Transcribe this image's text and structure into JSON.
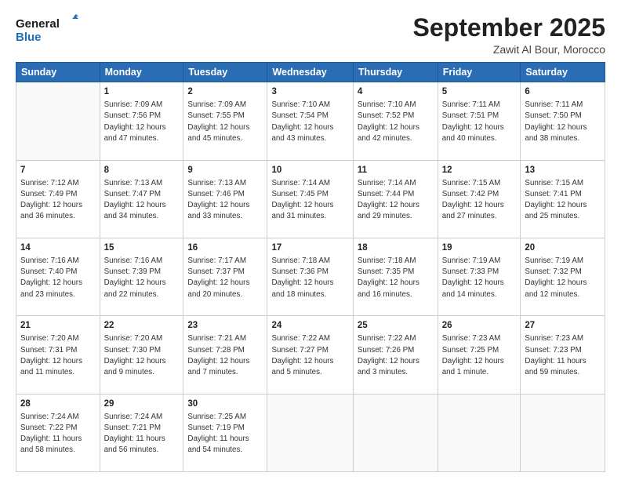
{
  "logo": {
    "line1": "General",
    "line2": "Blue"
  },
  "title": "September 2025",
  "location": "Zawit Al Bour, Morocco",
  "days_header": [
    "Sunday",
    "Monday",
    "Tuesday",
    "Wednesday",
    "Thursday",
    "Friday",
    "Saturday"
  ],
  "weeks": [
    [
      {
        "day": "",
        "info": ""
      },
      {
        "day": "1",
        "info": "Sunrise: 7:09 AM\nSunset: 7:56 PM\nDaylight: 12 hours\nand 47 minutes."
      },
      {
        "day": "2",
        "info": "Sunrise: 7:09 AM\nSunset: 7:55 PM\nDaylight: 12 hours\nand 45 minutes."
      },
      {
        "day": "3",
        "info": "Sunrise: 7:10 AM\nSunset: 7:54 PM\nDaylight: 12 hours\nand 43 minutes."
      },
      {
        "day": "4",
        "info": "Sunrise: 7:10 AM\nSunset: 7:52 PM\nDaylight: 12 hours\nand 42 minutes."
      },
      {
        "day": "5",
        "info": "Sunrise: 7:11 AM\nSunset: 7:51 PM\nDaylight: 12 hours\nand 40 minutes."
      },
      {
        "day": "6",
        "info": "Sunrise: 7:11 AM\nSunset: 7:50 PM\nDaylight: 12 hours\nand 38 minutes."
      }
    ],
    [
      {
        "day": "7",
        "info": "Sunrise: 7:12 AM\nSunset: 7:49 PM\nDaylight: 12 hours\nand 36 minutes."
      },
      {
        "day": "8",
        "info": "Sunrise: 7:13 AM\nSunset: 7:47 PM\nDaylight: 12 hours\nand 34 minutes."
      },
      {
        "day": "9",
        "info": "Sunrise: 7:13 AM\nSunset: 7:46 PM\nDaylight: 12 hours\nand 33 minutes."
      },
      {
        "day": "10",
        "info": "Sunrise: 7:14 AM\nSunset: 7:45 PM\nDaylight: 12 hours\nand 31 minutes."
      },
      {
        "day": "11",
        "info": "Sunrise: 7:14 AM\nSunset: 7:44 PM\nDaylight: 12 hours\nand 29 minutes."
      },
      {
        "day": "12",
        "info": "Sunrise: 7:15 AM\nSunset: 7:42 PM\nDaylight: 12 hours\nand 27 minutes."
      },
      {
        "day": "13",
        "info": "Sunrise: 7:15 AM\nSunset: 7:41 PM\nDaylight: 12 hours\nand 25 minutes."
      }
    ],
    [
      {
        "day": "14",
        "info": "Sunrise: 7:16 AM\nSunset: 7:40 PM\nDaylight: 12 hours\nand 23 minutes."
      },
      {
        "day": "15",
        "info": "Sunrise: 7:16 AM\nSunset: 7:39 PM\nDaylight: 12 hours\nand 22 minutes."
      },
      {
        "day": "16",
        "info": "Sunrise: 7:17 AM\nSunset: 7:37 PM\nDaylight: 12 hours\nand 20 minutes."
      },
      {
        "day": "17",
        "info": "Sunrise: 7:18 AM\nSunset: 7:36 PM\nDaylight: 12 hours\nand 18 minutes."
      },
      {
        "day": "18",
        "info": "Sunrise: 7:18 AM\nSunset: 7:35 PM\nDaylight: 12 hours\nand 16 minutes."
      },
      {
        "day": "19",
        "info": "Sunrise: 7:19 AM\nSunset: 7:33 PM\nDaylight: 12 hours\nand 14 minutes."
      },
      {
        "day": "20",
        "info": "Sunrise: 7:19 AM\nSunset: 7:32 PM\nDaylight: 12 hours\nand 12 minutes."
      }
    ],
    [
      {
        "day": "21",
        "info": "Sunrise: 7:20 AM\nSunset: 7:31 PM\nDaylight: 12 hours\nand 11 minutes."
      },
      {
        "day": "22",
        "info": "Sunrise: 7:20 AM\nSunset: 7:30 PM\nDaylight: 12 hours\nand 9 minutes."
      },
      {
        "day": "23",
        "info": "Sunrise: 7:21 AM\nSunset: 7:28 PM\nDaylight: 12 hours\nand 7 minutes."
      },
      {
        "day": "24",
        "info": "Sunrise: 7:22 AM\nSunset: 7:27 PM\nDaylight: 12 hours\nand 5 minutes."
      },
      {
        "day": "25",
        "info": "Sunrise: 7:22 AM\nSunset: 7:26 PM\nDaylight: 12 hours\nand 3 minutes."
      },
      {
        "day": "26",
        "info": "Sunrise: 7:23 AM\nSunset: 7:25 PM\nDaylight: 12 hours\nand 1 minute."
      },
      {
        "day": "27",
        "info": "Sunrise: 7:23 AM\nSunset: 7:23 PM\nDaylight: 11 hours\nand 59 minutes."
      }
    ],
    [
      {
        "day": "28",
        "info": "Sunrise: 7:24 AM\nSunset: 7:22 PM\nDaylight: 11 hours\nand 58 minutes."
      },
      {
        "day": "29",
        "info": "Sunrise: 7:24 AM\nSunset: 7:21 PM\nDaylight: 11 hours\nand 56 minutes."
      },
      {
        "day": "30",
        "info": "Sunrise: 7:25 AM\nSunset: 7:19 PM\nDaylight: 11 hours\nand 54 minutes."
      },
      {
        "day": "",
        "info": ""
      },
      {
        "day": "",
        "info": ""
      },
      {
        "day": "",
        "info": ""
      },
      {
        "day": "",
        "info": ""
      }
    ]
  ]
}
